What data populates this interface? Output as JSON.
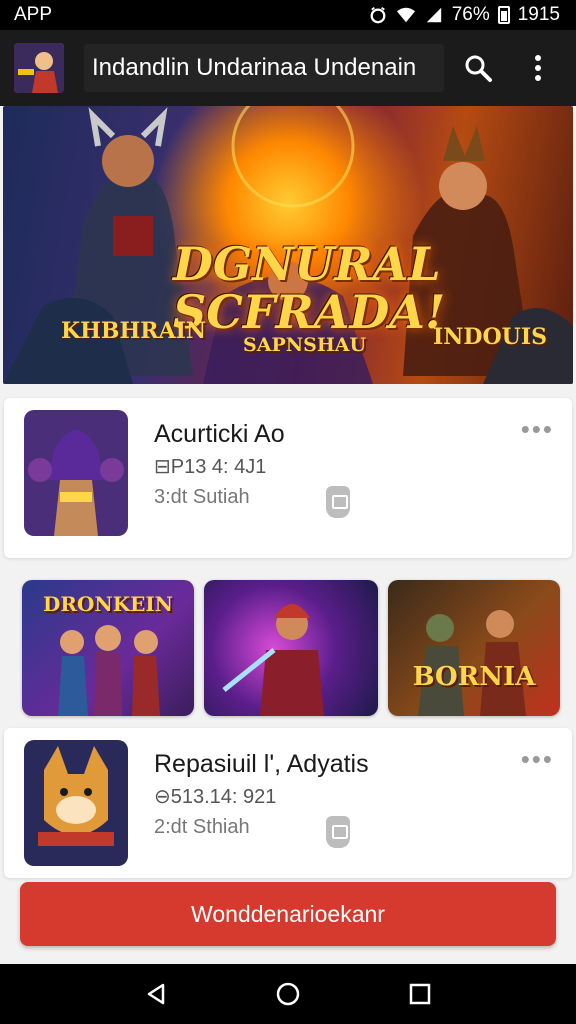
{
  "status_bar": {
    "app_label": "APP",
    "battery": "76%",
    "time": "1915"
  },
  "app_bar": {
    "title": "Indandlin Undarinaa Undenain"
  },
  "banner": {
    "title_line1": "DGNURAL",
    "title_line2": "SCFRADA!",
    "left_label": "KHBHRAIN",
    "center_label": "SAPNSHAU",
    "right_label": "INDOUIS"
  },
  "cards": [
    {
      "title": "Acurticki Ao",
      "meta1": "⊟P13 4: 4J1",
      "meta2": "3:dt Sutiah"
    },
    {
      "title": "Repasiuil l', Adyatis",
      "meta1": "⊖513.14: 921",
      "meta2": "2:dt Sthiah"
    }
  ],
  "grid": [
    {
      "label": "DRONKEIN"
    },
    {
      "label": ""
    },
    {
      "label": "BORNIA"
    }
  ],
  "cta": {
    "label": "Wonddenarioekanr"
  },
  "colors": {
    "accent": "#d63a2f",
    "app_bar": "#1b1b1b"
  }
}
